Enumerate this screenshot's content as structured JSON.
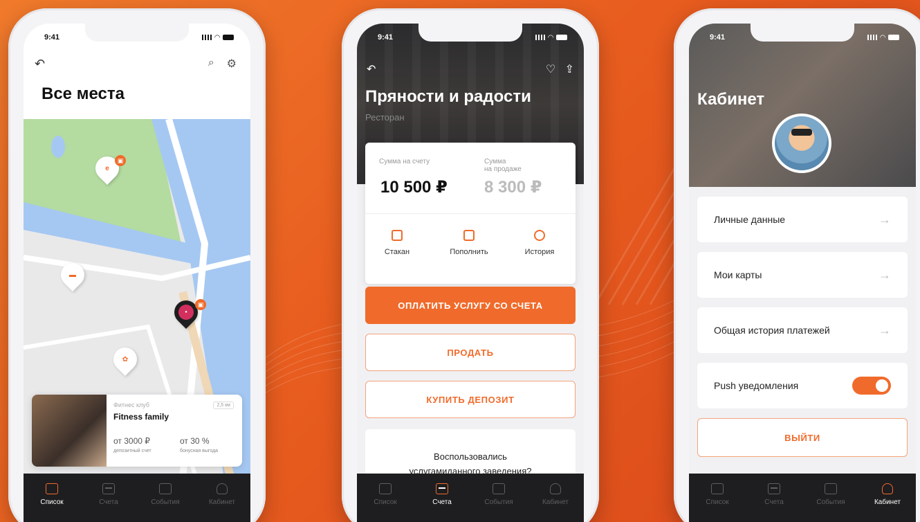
{
  "colors": {
    "accent": "#f06b2b",
    "dark": "#1e1e20"
  },
  "status": {
    "time": "9:41"
  },
  "tabs": [
    "Список",
    "Счета",
    "События",
    "Кабинет"
  ],
  "phone1": {
    "title": "Все места",
    "card": {
      "category": "Фитнес клуб",
      "distance": "2,5 км",
      "name": "Fitness family",
      "deposit_value": "от 3000 ₽",
      "deposit_label": "депозитный счет",
      "bonus_value": "от 30 %",
      "bonus_label": "бонусная выгода"
    }
  },
  "phone2": {
    "title": "Пряности и радости",
    "subtitle": "Ресторан",
    "balance_label": "Сумма на счету",
    "balance_value": "10 500 ₽",
    "sale_label_1": "Сумма",
    "sale_label_2": "на продаже",
    "sale_value": "8 300 ₽",
    "actions": [
      "Стакан",
      "Пополнить",
      "История"
    ],
    "pay_button": "ОПЛАТИТЬ УСЛУГУ СО СЧЕТА",
    "sell_button": "ПРОДАТЬ",
    "buy_button": "КУПИТЬ ДЕПОЗИТ",
    "question_line1": "Воспользовались",
    "question_line2": "услугамиданного заведения?"
  },
  "phone3": {
    "title": "Кабинет",
    "menu": [
      "Личные данные",
      "Мои карты",
      "Общая история платежей"
    ],
    "push_label": "Push уведомления",
    "push_enabled": true,
    "logout": "ВЫЙТИ"
  }
}
